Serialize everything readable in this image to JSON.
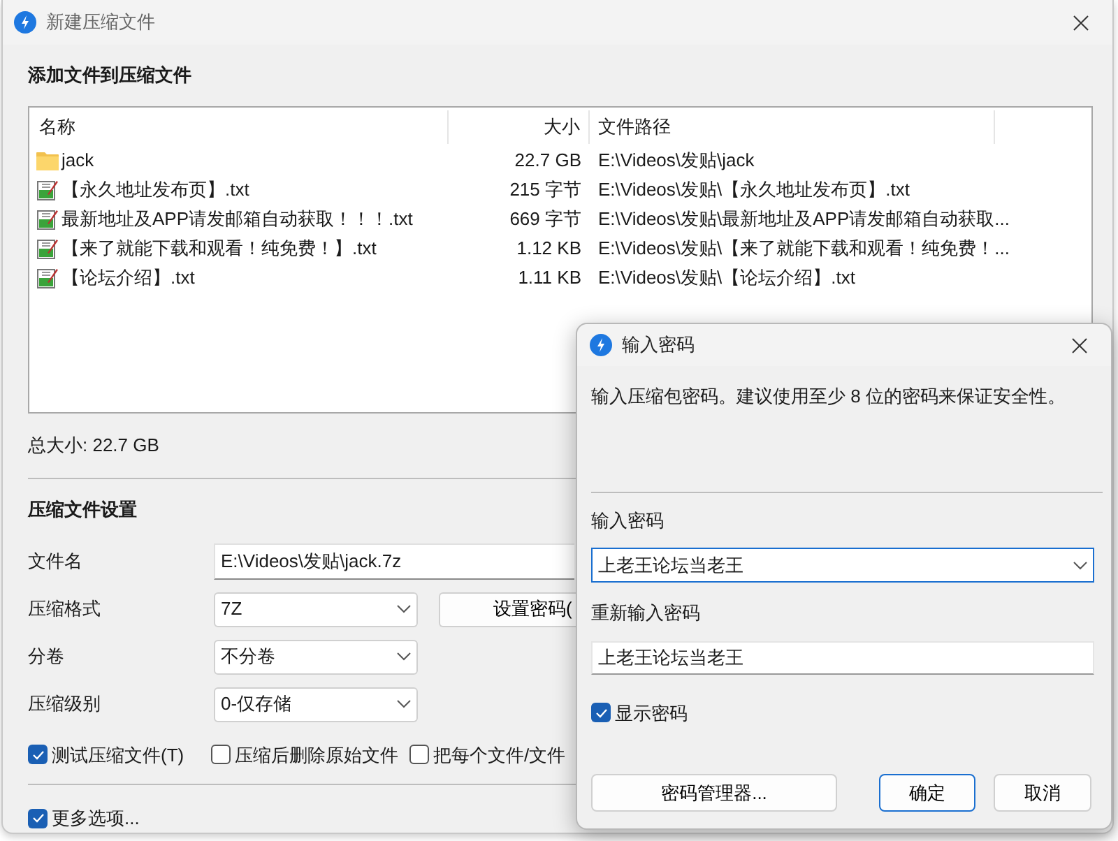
{
  "main_window": {
    "title": "新建压缩文件",
    "section_title": "添加文件到压缩文件",
    "file_list": {
      "columns": [
        "名称",
        "大小",
        "文件路径"
      ],
      "rows": [
        {
          "kind": "folder",
          "name": "jack",
          "size": "22.7 GB",
          "path": "E:\\Videos\\发贴\\jack"
        },
        {
          "kind": "text",
          "name": "【永久地址发布页】.txt",
          "size": "215 字节",
          "path": "E:\\Videos\\发贴\\【永久地址发布页】.txt"
        },
        {
          "kind": "text",
          "name": "最新地址及APP请发邮箱自动获取！！！.txt",
          "size": "669 字节",
          "path": "E:\\Videos\\发贴\\最新地址及APP请发邮箱自动获取..."
        },
        {
          "kind": "text",
          "name": "【来了就能下载和观看！纯免费！】.txt",
          "size": "1.12 KB",
          "path": "E:\\Videos\\发贴\\【来了就能下载和观看！纯免费！..."
        },
        {
          "kind": "text",
          "name": "【论坛介绍】.txt",
          "size": "1.11 KB",
          "path": "E:\\Videos\\发贴\\【论坛介绍】.txt"
        }
      ]
    },
    "total_size": "总大小: 22.7 GB",
    "settings_title": "压缩文件设置",
    "filename": {
      "label": "文件名",
      "value": "E:\\Videos\\发贴\\jack.7z"
    },
    "format": {
      "label": "压缩格式",
      "value": "7Z"
    },
    "set_password_button": "设置密码(",
    "split": {
      "label": "分卷",
      "value": "不分卷"
    },
    "level": {
      "label": "压缩级别",
      "value": "0-仅存储"
    },
    "options": [
      {
        "label": "测试压缩文件(T)",
        "checked": true
      },
      {
        "label": "压缩后删除原始文件",
        "checked": false
      },
      {
        "label": "把每个文件/文件",
        "checked": false
      }
    ],
    "more_options": {
      "label": "更多选项...",
      "checked": true
    }
  },
  "dialog": {
    "title": "输入密码",
    "description": "输入压缩包密码。建议使用至少 8 位的密码来保证安全性。",
    "password_label": "输入密码",
    "password": {
      "value": "上老王论坛当老王",
      "focused": true
    },
    "confirm_label": "重新输入密码",
    "confirm": "上老王论坛当老王",
    "show_password": {
      "label": "显示密码",
      "checked": true
    },
    "buttons": [
      {
        "label": "密码管理器...",
        "default": false
      },
      {
        "label": "确定",
        "default": true
      },
      {
        "label": "取消",
        "default": false
      }
    ]
  }
}
